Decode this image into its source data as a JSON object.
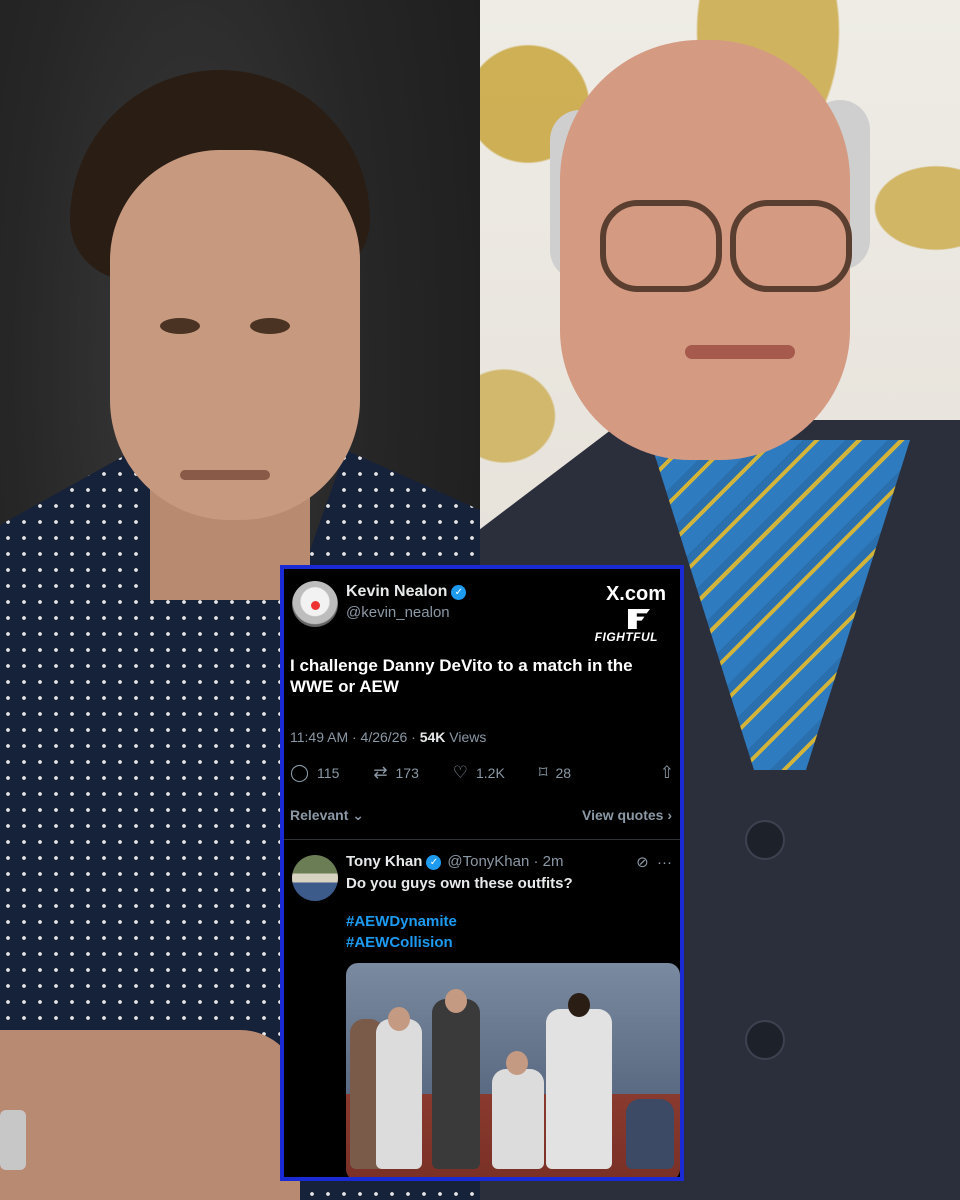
{
  "tweet": {
    "author_name": "Kevin Nealon",
    "author_handle": "@kevin_nealon",
    "brand": "X.com",
    "watermark": "FIGHTFUL",
    "text": "I challenge Danny DeVito to a match in the WWE or AEW",
    "time": "11:49 AM · 4/26/26 · ",
    "views_count": "54K",
    "views_label": " Views",
    "replies": "115",
    "reposts": "173",
    "likes": "1.2K",
    "bookmarks": "28",
    "sort_label": "Relevant",
    "view_quotes_label": "View quotes"
  },
  "reply": {
    "author_name": "Tony Khan",
    "author_handle": "@TonyKhan · 2m",
    "text": "Do you guys own these outfits?",
    "hashtags": [
      "#AEWDynamite",
      "#AEWCollision"
    ]
  },
  "icons": {
    "verified": "verified-badge-icon",
    "reply": "reply-icon",
    "repost": "repost-icon",
    "like": "heart-icon",
    "bookmark": "bookmark-icon",
    "share": "share-icon"
  },
  "colors": {
    "frame": "#1a2bd6",
    "accent": "#1d9bf0",
    "background": "#000000"
  }
}
